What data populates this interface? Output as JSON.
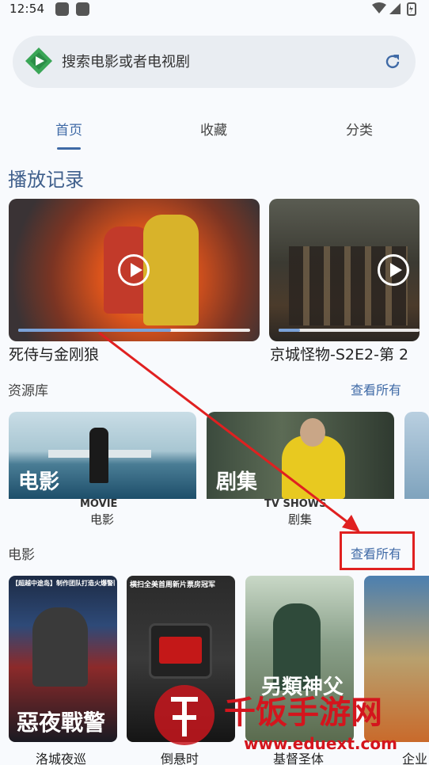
{
  "status": {
    "time": "12:54"
  },
  "search": {
    "placeholder": "搜索电影或者电视剧"
  },
  "tabs": [
    {
      "label": "首页",
      "active": true
    },
    {
      "label": "收藏"
    },
    {
      "label": "分类"
    }
  ],
  "history": {
    "title": "播放记录",
    "items": [
      {
        "title": "死侍与金刚狼",
        "progress": 0.66
      },
      {
        "title": "京城怪物-S2E2-第 2",
        "progress": 0.15
      }
    ]
  },
  "library": {
    "title": "资源库",
    "see_all": "查看所有",
    "items": [
      {
        "overlay": "电影",
        "english": "MOVIE",
        "label": "电影"
      },
      {
        "overlay": "剧集",
        "english": "TV SHOWS",
        "label": "剧集"
      }
    ]
  },
  "movies": {
    "title": "电影",
    "see_all": "查看所有",
    "items": [
      {
        "caption": "洛城夜巡",
        "poster_top": "【超越中途岛】制作团队打造火爆警匪片",
        "poster_title": "惡夜戰警"
      },
      {
        "caption": "倒悬时",
        "poster_top": "横扫全美首周新片票房冠军",
        "poster_title": ""
      },
      {
        "caption": "基督圣体",
        "poster_top": "",
        "poster_title": "另類神父"
      },
      {
        "caption": "企业"
      }
    ]
  },
  "watermark": {
    "text": "千饭手游网",
    "url": "www.eduext.com"
  },
  "colors": {
    "accent": "#3f6aa6",
    "annotation": "#e02020"
  }
}
